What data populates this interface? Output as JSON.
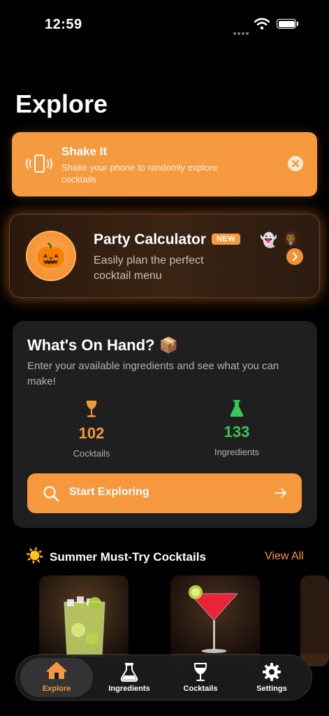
{
  "status_bar": {
    "time": "12:59"
  },
  "page": {
    "title": "Explore"
  },
  "shake_card": {
    "title": "Shake It",
    "description": "Shake your phone to randomly explore cocktails"
  },
  "party_card": {
    "title": "Party Calculator",
    "badge": "NEW",
    "description": "Easily plan the perfect cocktail menu",
    "emojis": [
      "🎃",
      "👻",
      "🧛"
    ]
  },
  "on_hand": {
    "title": "What's On Hand? 📦",
    "description": "Enter your available ingredients and see what you can make!",
    "stats": [
      {
        "value": "102",
        "label": "Cocktails",
        "color": "#f6993e",
        "icon": "wine-glass-icon"
      },
      {
        "value": "133",
        "label": "Ingredients",
        "color": "#34c759",
        "icon": "flask-icon"
      }
    ],
    "button_label": "Start Exploring"
  },
  "summer": {
    "icon": "☀️",
    "title": "Summer Must-Try Cocktails",
    "view_all": "View All"
  },
  "tabs": [
    {
      "label": "Explore",
      "icon": "home-icon",
      "active": true
    },
    {
      "label": "Ingredients",
      "icon": "flask-icon",
      "active": false
    },
    {
      "label": "Cocktails",
      "icon": "wine-glass-icon",
      "active": false
    },
    {
      "label": "Settings",
      "icon": "gear-icon",
      "active": false
    }
  ],
  "colors": {
    "accent": "#f6993e",
    "green": "#34c759",
    "card": "#1f1f1f",
    "background": "#000000"
  }
}
